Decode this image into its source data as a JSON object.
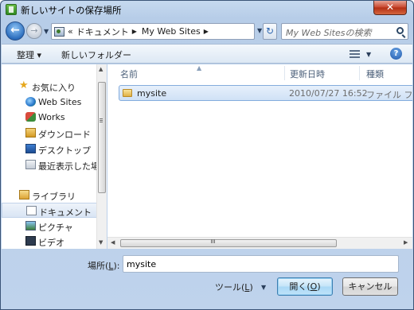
{
  "window": {
    "title": "新しいサイトの保存場所",
    "close_label": "✕"
  },
  "address_bar": {
    "path": [
      "«",
      "ドキュメント",
      "My Web Sites"
    ],
    "search_placeholder": "My Web Sitesの検索"
  },
  "command_bar": {
    "organize": "整理 ▾",
    "new_folder": "新しいフォルダー",
    "help": "?"
  },
  "nav": {
    "favorites_header": "お気に入り",
    "favorites": [
      "Web Sites",
      "Works",
      "ダウンロード",
      "デスクトップ",
      "最近表示した場所"
    ],
    "libraries_header": "ライブラリ",
    "libraries": [
      "ドキュメント",
      "ピクチャ",
      "ビデオ"
    ],
    "selected": "ドキュメント"
  },
  "columns": [
    "名前",
    "更新日時",
    "種類"
  ],
  "rows": [
    {
      "name": "mysite",
      "date": "2010/07/27 16:52",
      "type": "ファイル フ"
    }
  ],
  "footer": {
    "filename_label_pre": "場所(",
    "filename_label_key": "L",
    "filename_label_post": "):",
    "filename_value": "mysite",
    "tools_pre": "ツール(",
    "tools_key": "L",
    "tools_post": ")",
    "open_pre": "開く(",
    "open_key": "O",
    "open_post": ")",
    "cancel": "キャンセル"
  },
  "colors": {
    "accent": "#3c7fb1",
    "selection": "#cfe1f6",
    "chrome": "#bfd3ec"
  }
}
